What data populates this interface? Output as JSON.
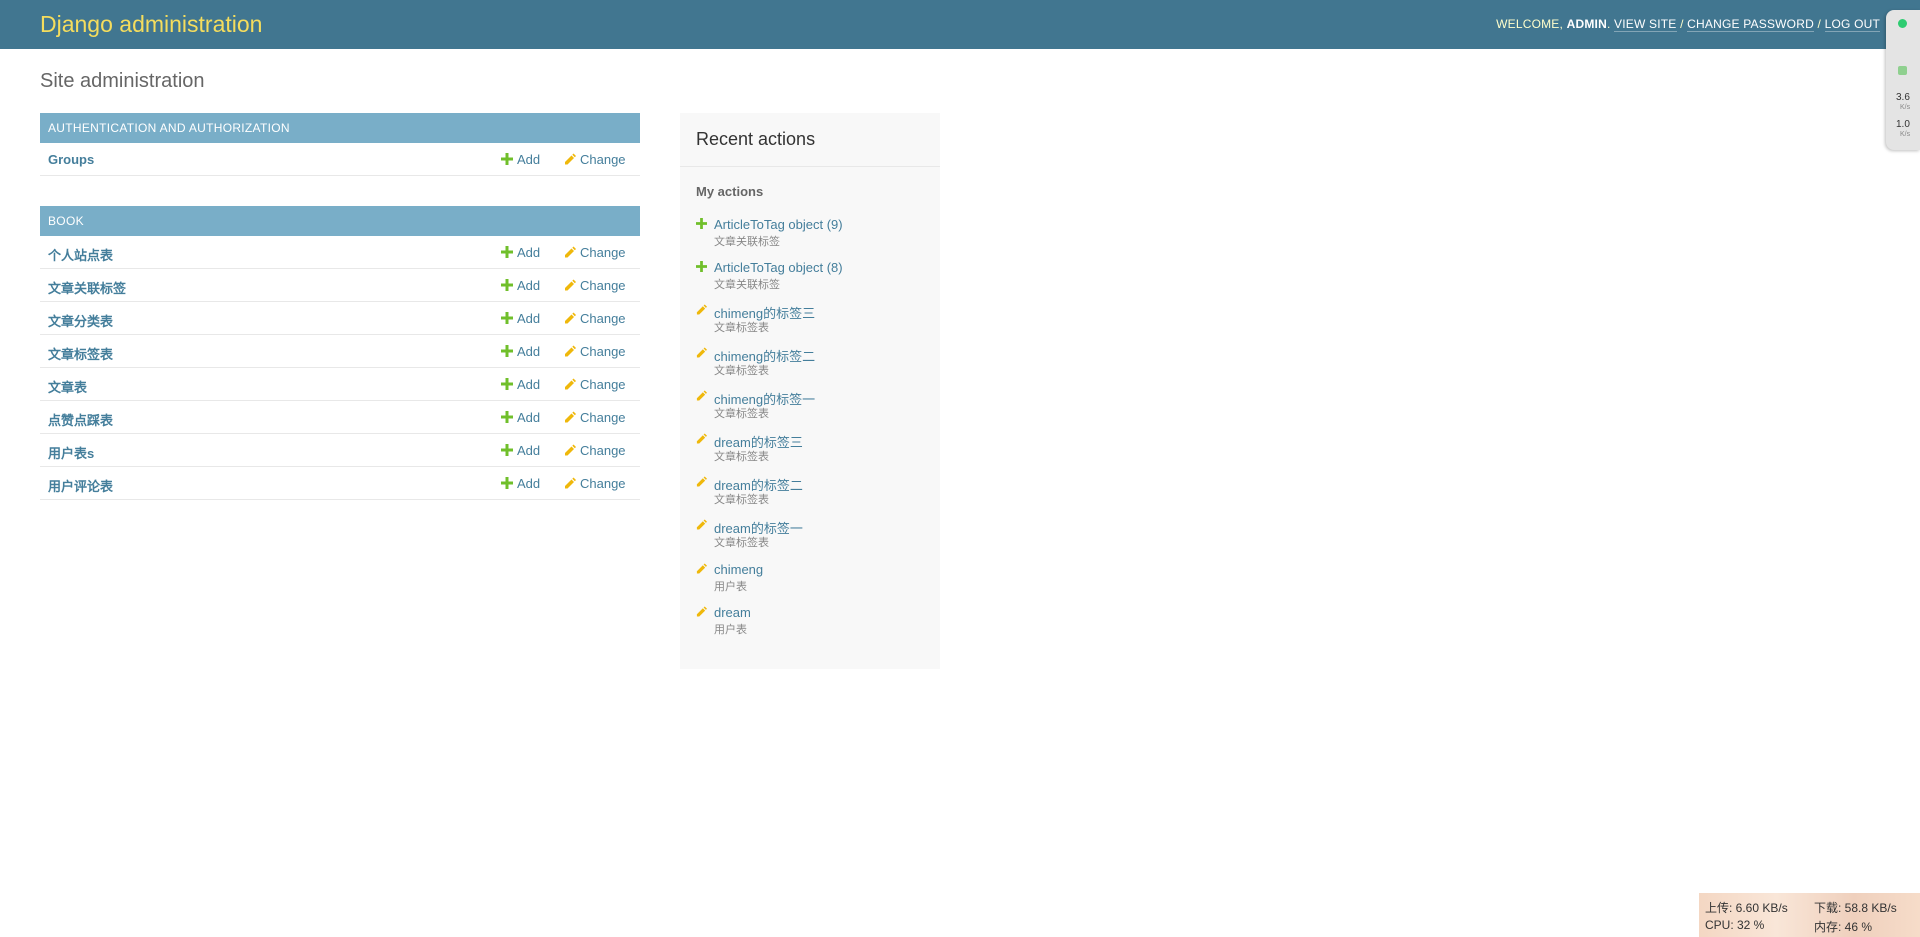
{
  "header": {
    "branding": "Django administration",
    "welcome_prefix": "WELCOME,",
    "username": "ADMIN",
    "welcome_suffix": ".",
    "view_site": "VIEW SITE",
    "sep1": "/",
    "change_password": "CHANGE PASSWORD",
    "sep2": "/",
    "log_out": "LOG OUT"
  },
  "page_title": "Site administration",
  "apps": [
    {
      "caption": "AUTHENTICATION AND AUTHORIZATION",
      "models": [
        {
          "name": "Groups",
          "add": "Add",
          "change": "Change"
        }
      ]
    },
    {
      "caption": "BOOK",
      "models": [
        {
          "name": "个人站点表",
          "add": "Add",
          "change": "Change"
        },
        {
          "name": "文章关联标签",
          "add": "Add",
          "change": "Change"
        },
        {
          "name": "文章分类表",
          "add": "Add",
          "change": "Change"
        },
        {
          "name": "文章标签表",
          "add": "Add",
          "change": "Change"
        },
        {
          "name": "文章表",
          "add": "Add",
          "change": "Change"
        },
        {
          "name": "点赞点踩表",
          "add": "Add",
          "change": "Change"
        },
        {
          "name": "用户表s",
          "add": "Add",
          "change": "Change"
        },
        {
          "name": "用户评论表",
          "add": "Add",
          "change": "Change"
        }
      ]
    }
  ],
  "recent_actions": {
    "title": "Recent actions",
    "my_actions": "My actions",
    "items": [
      {
        "icon": "add-icon",
        "label": "ArticleToTag object (9)",
        "type": "文章关联标签"
      },
      {
        "icon": "add-icon",
        "label": "ArticleToTag object (8)",
        "type": "文章关联标签"
      },
      {
        "icon": "change-icon",
        "label": "chimeng的标签三",
        "type": "文章标签表"
      },
      {
        "icon": "change-icon",
        "label": "chimeng的标签二",
        "type": "文章标签表"
      },
      {
        "icon": "change-icon",
        "label": "chimeng的标签一",
        "type": "文章标签表"
      },
      {
        "icon": "change-icon",
        "label": "dream的标签三",
        "type": "文章标签表"
      },
      {
        "icon": "change-icon",
        "label": "dream的标签二",
        "type": "文章标签表"
      },
      {
        "icon": "change-icon",
        "label": "dream的标签一",
        "type": "文章标签表"
      },
      {
        "icon": "change-icon",
        "label": "chimeng",
        "type": "用户表"
      },
      {
        "icon": "change-icon",
        "label": "dream",
        "type": "用户表"
      }
    ]
  },
  "speed_widget": {
    "upload_value": "3.6",
    "upload_unit": "K/s",
    "download_value": "1.0",
    "download_unit": "K/s"
  },
  "system_monitor": {
    "upload": "上传: 6.60 KB/s",
    "download": "下载: 58.8 KB/s",
    "cpu": "CPU: 32 %",
    "memory": "内存: 46 %"
  },
  "colors": {
    "header_bg": "#417690",
    "branding": "#f5dd5d",
    "caption_bg": "#79aec8",
    "link": "#447e9b",
    "add_green": "#70bf2b",
    "change_yellow": "#efb80b"
  }
}
